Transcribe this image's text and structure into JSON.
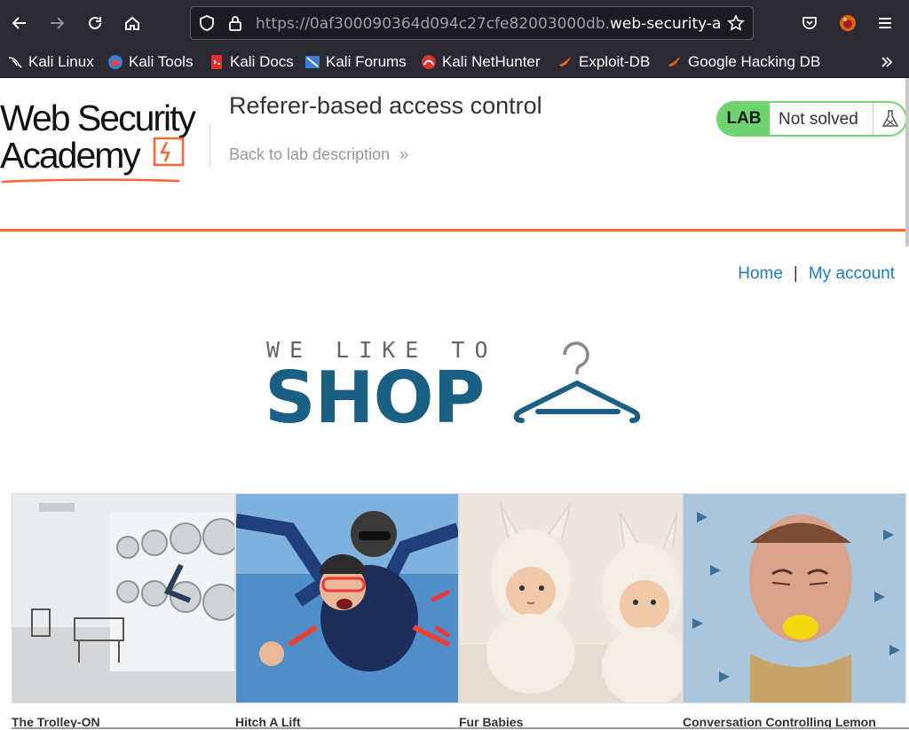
{
  "browser": {
    "url_prefix": "https://0af300090364d094c27cfe82003000db.",
    "url_host": "web-security-ac"
  },
  "bookmarks": [
    {
      "label": "Kali Linux",
      "icon": "kali-icon"
    },
    {
      "label": "Kali Tools",
      "icon": "kali-tools-icon"
    },
    {
      "label": "Kali Docs",
      "icon": "kali-docs-icon"
    },
    {
      "label": "Kali Forums",
      "icon": "kali-forums-icon"
    },
    {
      "label": "Kali NetHunter",
      "icon": "nethunter-icon"
    },
    {
      "label": "Exploit-DB",
      "icon": "exploit-db-icon"
    },
    {
      "label": "Google Hacking DB",
      "icon": "ghdb-icon"
    }
  ],
  "header": {
    "logo_line1": "Web Security",
    "logo_line2": "Academy",
    "lab_title": "Referer-based access control",
    "back_link": "Back to lab description",
    "back_chevron": "»",
    "lab_tag": "LAB",
    "lab_status": "Not solved"
  },
  "nav": {
    "home": "Home",
    "separator": "|",
    "my_account": "My account"
  },
  "shop_logo": {
    "tagline": "WE LIKE TO",
    "shop": "SHOP"
  },
  "products": [
    {
      "name": "The Trolley-ON"
    },
    {
      "name": "Hitch A Lift"
    },
    {
      "name": "Fur Babies"
    },
    {
      "name": "Conversation Controlling Lemon"
    }
  ],
  "colors": {
    "accent_orange": "#ff6633",
    "lab_green": "#6fd36f",
    "link_blue": "#1b7ac1",
    "shop_blue": "#1a5f84"
  }
}
